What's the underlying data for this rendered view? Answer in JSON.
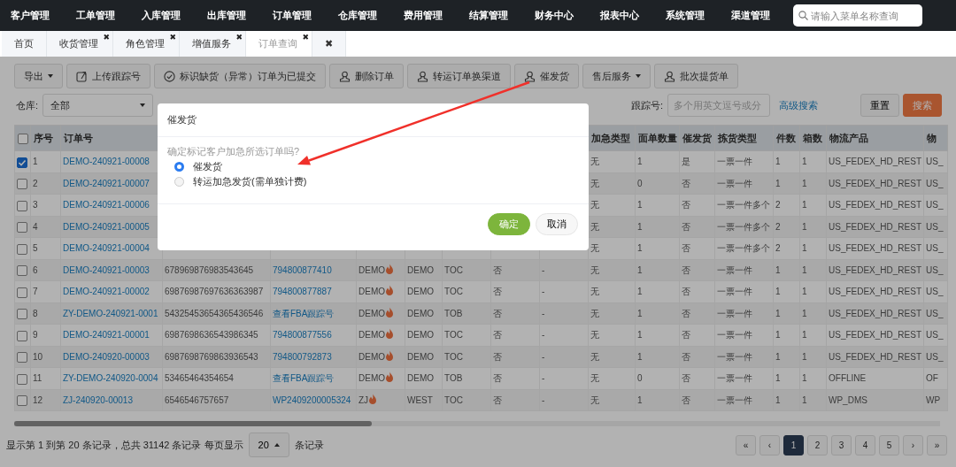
{
  "top_nav": {
    "items": [
      "客户管理",
      "工单管理",
      "入库管理",
      "出库管理",
      "订单管理",
      "仓库管理",
      "费用管理",
      "结算管理",
      "财务中心",
      "报表中心",
      "系统管理",
      "渠道管理"
    ],
    "search": {
      "placeholder": "请输入菜单名称查询"
    }
  },
  "tabs": [
    {
      "label": "首页",
      "selected": false
    },
    {
      "label": "收货管理",
      "close": "✖",
      "selected": false
    },
    {
      "label": "角色管理",
      "close": "✖",
      "selected": false
    },
    {
      "label": "增值服务",
      "close": "✖",
      "selected": false
    },
    {
      "label": "订单查询",
      "close": "✖",
      "selected": true
    },
    {
      "label": "✖",
      "selected": false
    }
  ],
  "toolbar": [
    {
      "label": "导出",
      "kind": "dropdown"
    },
    {
      "label": "上传跟踪号",
      "kind": "upload"
    },
    {
      "label": "标识缺货（异常）订单为已提交",
      "kind": "check"
    },
    {
      "label": "删除订单",
      "kind": "user"
    },
    {
      "label": "转运订单换渠道",
      "kind": "user"
    },
    {
      "label": "催发货",
      "kind": "user"
    },
    {
      "label": "售后服务",
      "kind": "dropdown"
    },
    {
      "label": "批次提货单",
      "kind": "user"
    }
  ],
  "filters": [
    {
      "label": "仓库:",
      "kind": "select",
      "value": "全部"
    },
    {
      "label": "跟踪号:",
      "kind": "input",
      "placeholder": "多个用英文逗号或分"
    }
  ],
  "advanced_search": "高级搜索",
  "filter_buttons": [
    {
      "label": "重置",
      "kind": "default"
    },
    {
      "label": "搜索",
      "kind": "primary"
    }
  ],
  "table": {
    "header_checked": false,
    "columns": [
      {
        "label": "序号",
        "kind": "text"
      },
      {
        "label": "订单号",
        "kind": "link"
      },
      {
        "kind": "text"
      },
      {
        "kind": "link"
      },
      {
        "kind": "customer"
      },
      {
        "kind": "text"
      },
      {
        "kind": "text"
      },
      {
        "kind": "text"
      },
      {
        "kind": "text"
      },
      {
        "label": "加急类型",
        "kind": "text"
      },
      {
        "label": "面单数量",
        "kind": "text"
      },
      {
        "label": "催发货",
        "kind": "text"
      },
      {
        "label": "拣货类型",
        "kind": "text"
      },
      {
        "label": "件数",
        "kind": "text"
      },
      {
        "label": "箱数",
        "kind": "text"
      },
      {
        "label": "物流产品",
        "kind": "text"
      },
      {
        "label": "物",
        "kind": "text"
      }
    ],
    "rows": [
      {
        "checked": true,
        "cells": [
          "1",
          "DEMO-240921-00008",
          null,
          null,
          null,
          null,
          null,
          null,
          null,
          "无",
          "1",
          "是",
          "一票一件",
          "1",
          "1",
          "US_FEDEX_HD_REST",
          "US_"
        ]
      },
      {
        "checked": false,
        "cells": [
          "2",
          "DEMO-240921-00007",
          null,
          null,
          null,
          null,
          null,
          null,
          null,
          "无",
          "0",
          "否",
          "一票一件",
          "1",
          "1",
          "US_FEDEX_HD_REST",
          "US_"
        ]
      },
      {
        "checked": false,
        "cells": [
          "3",
          "DEMO-240921-00006",
          null,
          null,
          null,
          null,
          null,
          null,
          null,
          "无",
          "1",
          "否",
          "一票一件多个",
          "2",
          "1",
          "US_FEDEX_HD_REST",
          "US_"
        ]
      },
      {
        "checked": false,
        "cells": [
          "4",
          "DEMO-240921-00005",
          null,
          null,
          null,
          null,
          null,
          null,
          null,
          "无",
          "1",
          "否",
          "一票一件多个",
          "2",
          "1",
          "US_FEDEX_HD_REST",
          "US_"
        ]
      },
      {
        "checked": false,
        "cells": [
          "5",
          "DEMO-240921-00004",
          null,
          null,
          null,
          null,
          null,
          null,
          null,
          "无",
          "1",
          "否",
          "一票一件多个",
          "2",
          "1",
          "US_FEDEX_HD_REST",
          "US_"
        ]
      },
      {
        "checked": false,
        "urgent": true,
        "cells": [
          "6",
          "DEMO-240921-00003",
          "678969876983543645",
          "794800877410",
          "DEMO",
          "DEMO",
          "TOC",
          "否",
          "-",
          "无",
          "1",
          "否",
          "一票一件",
          "1",
          "1",
          "US_FEDEX_HD_REST",
          "US_"
        ]
      },
      {
        "checked": false,
        "urgent": true,
        "cells": [
          "7",
          "DEMO-240921-00002",
          "69876987697636363987",
          "794800877887",
          "DEMO",
          "DEMO",
          "TOC",
          "否",
          "-",
          "无",
          "1",
          "否",
          "一票一件",
          "1",
          "1",
          "US_FEDEX_HD_REST",
          "US_"
        ]
      },
      {
        "checked": false,
        "urgent": true,
        "cells": [
          "8",
          "ZY-DEMO-240921-0001",
          "54325453654365436546",
          "查看FBA跟踪号",
          "DEMO",
          "DEMO",
          "TOB",
          "否",
          "-",
          "无",
          "1",
          "否",
          "一票一件",
          "1",
          "1",
          "US_FEDEX_HD_REST",
          "US_"
        ]
      },
      {
        "checked": false,
        "urgent": true,
        "cells": [
          "9",
          "DEMO-240921-00001",
          "6987698636543986345",
          "794800877556",
          "DEMO",
          "DEMO",
          "TOC",
          "否",
          "-",
          "无",
          "1",
          "否",
          "一票一件",
          "1",
          "1",
          "US_FEDEX_HD_REST",
          "US_"
        ]
      },
      {
        "checked": false,
        "urgent": true,
        "cells": [
          "10",
          "DEMO-240920-00003",
          "6987698769863936543",
          "794800792873",
          "DEMO",
          "DEMO",
          "TOC",
          "否",
          "-",
          "无",
          "1",
          "否",
          "一票一件",
          "1",
          "1",
          "US_FEDEX_HD_REST",
          "US_"
        ]
      },
      {
        "checked": false,
        "urgent": true,
        "cells": [
          "11",
          "ZY-DEMO-240920-0004",
          "53465464354654",
          "查看FBA跟踪号",
          "DEMO",
          "DEMO",
          "TOB",
          "否",
          "-",
          "无",
          "0",
          "否",
          "一票一件",
          "1",
          "1",
          "OFFLINE",
          "OF"
        ]
      },
      {
        "checked": false,
        "urgent": true,
        "cells": [
          "12",
          "ZJ-240920-00013",
          "6546546757657",
          "WP2409200005324",
          "ZJ",
          "WEST",
          "TOC",
          "否",
          "-",
          "无",
          "1",
          "否",
          "一票一件",
          "1",
          "1",
          "WP_DMS",
          "WP"
        ]
      }
    ]
  },
  "footer": {
    "summary": "显示第 1 到第 20 条记录，总共 31142 条记录 每页显示",
    "page_size": "20",
    "suffix": "条记录",
    "pages": [
      {
        "label": "«",
        "selected": false
      },
      {
        "label": "‹",
        "selected": false
      },
      {
        "label": "1",
        "selected": true
      },
      {
        "label": "2",
        "selected": false
      },
      {
        "label": "3",
        "selected": false
      },
      {
        "label": "4",
        "selected": false
      },
      {
        "label": "5",
        "selected": false
      },
      {
        "label": "›",
        "selected": false
      },
      {
        "label": "»",
        "selected": false
      }
    ]
  },
  "dialog": {
    "title": "催发货",
    "message": "确定标记客户加急所选订单吗?",
    "options": [
      {
        "label": "催发货",
        "selected": true
      },
      {
        "label": "转运加急发货(需单独计费)",
        "selected": false
      }
    ],
    "buttons": [
      {
        "label": "确定",
        "kind": "primary"
      },
      {
        "label": "取消",
        "kind": "default"
      }
    ]
  }
}
